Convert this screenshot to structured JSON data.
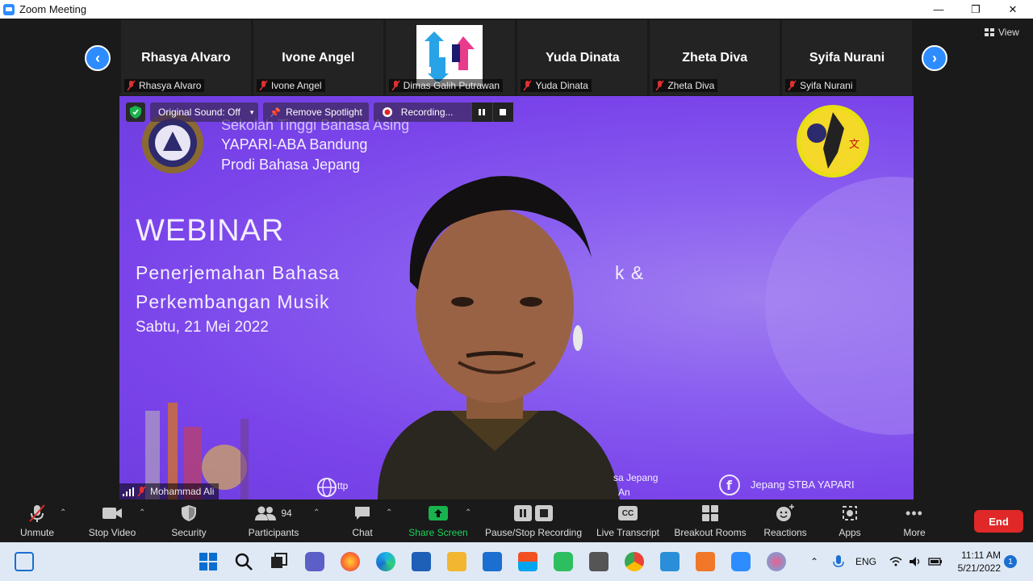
{
  "window": {
    "title": "Zoom Meeting",
    "minimize": "—",
    "maximize": "❐",
    "close": "✕"
  },
  "view": {
    "label": "View"
  },
  "thumbnails": [
    {
      "big_name": "Rhasya Alvaro",
      "name": "Rhasya Alvaro"
    },
    {
      "big_name": "Ivone Angel",
      "name": "Ivone Angel"
    },
    {
      "big_name": "",
      "name": "Dimas Galih Putrawan"
    },
    {
      "big_name": "Yuda Dinata",
      "name": "Yuda Dinata"
    },
    {
      "big_name": "Zheta Diva",
      "name": "Zheta Diva"
    },
    {
      "big_name": "Syifa Nurani",
      "name": "Syifa Nurani"
    }
  ],
  "spotlight": {
    "original_sound": "Original Sound: Off",
    "remove_spotlight": "Remove Spotlight",
    "recording": "Recording..."
  },
  "slide": {
    "line1": "Sekolah Tinggi Bahasa Asing",
    "line2": "YAPARI-ABA Bandung",
    "line3": "Prodi Bahasa Jepang",
    "webinar": "WEBINAR",
    "topic1": "Penerjemahan  Bahasa",
    "topic1_tail": "k &",
    "topic2": "Perkembangan Musik",
    "date": "Sabtu, 21 Mei 2022",
    "footer_left": "ttp",
    "footer_mid": "sa Jepang",
    "footer_mid2": "An",
    "footer_social": "Jepang STBA YAPARI"
  },
  "speaker": {
    "name": "Mohammad Ali"
  },
  "toolbar": {
    "unmute": "Unmute",
    "stop_video": "Stop Video",
    "security": "Security",
    "participants": "Participants",
    "participant_count": "94",
    "chat": "Chat",
    "share_screen": "Share Screen",
    "pause_stop_recording": "Pause/Stop Recording",
    "live_transcript": "Live Transcript",
    "cc": "CC",
    "breakout_rooms": "Breakout Rooms",
    "reactions": "Reactions",
    "apps": "Apps",
    "more": "More",
    "end": "End"
  },
  "taskbar": {
    "lang": "ENG",
    "time": "11:11 AM",
    "date": "5/21/2022",
    "notification_count": "1"
  },
  "colors": {
    "accent": "#2d8cff",
    "share_green": "#19b34d",
    "end_red": "#e02828",
    "slide_purple": "#7a44ea"
  }
}
